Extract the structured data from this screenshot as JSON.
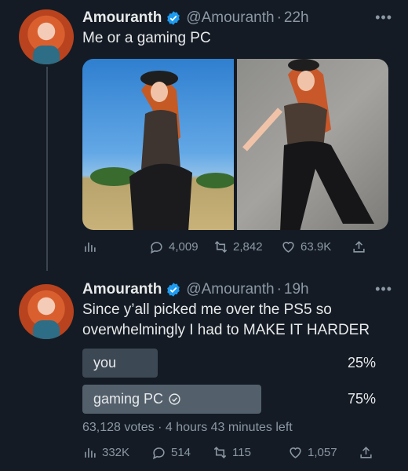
{
  "tweets": [
    {
      "author": "Amouranth",
      "handle": "@Amouranth",
      "time": "22h",
      "text": "Me or a gaming PC",
      "actions": {
        "views": "",
        "replies": "4,009",
        "retweets": "2,842",
        "likes": "63.9K"
      }
    },
    {
      "author": "Amouranth",
      "handle": "@Amouranth",
      "time": "19h",
      "text": "Since y’all picked me over the PS5 so overwhelmingly I had to MAKE IT HARDER",
      "poll": {
        "options": [
          {
            "label": "you",
            "percent": "25%",
            "fraction": 0.25
          },
          {
            "label": "gaming PC",
            "percent": "75%",
            "fraction": 0.75,
            "selected": true
          }
        ],
        "meta": "63,128 votes · 4 hours 43 minutes left"
      },
      "actions": {
        "views": "332K",
        "replies": "514",
        "retweets": "115",
        "likes": "1,057"
      }
    }
  ],
  "colors": {
    "background": "#141b24",
    "verified": "#1d9bf0",
    "muted": "#8b98a5"
  }
}
